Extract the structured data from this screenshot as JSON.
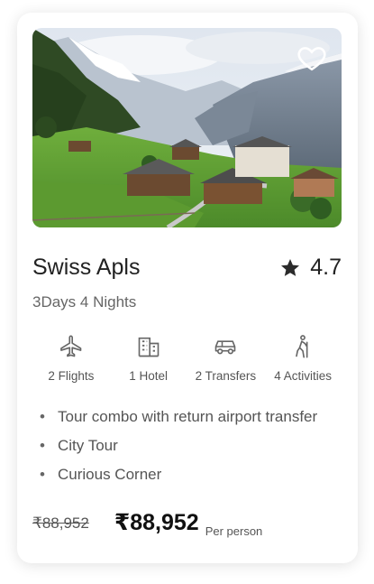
{
  "card": {
    "image_alt": "Swiss mountain village",
    "title": "Swiss Apls",
    "rating": "4.7",
    "subtitle": "3Days 4 Nights",
    "features": [
      {
        "icon": "flight-icon",
        "label": "2 Flights"
      },
      {
        "icon": "hotel-icon",
        "label": "1 Hotel"
      },
      {
        "icon": "car-icon",
        "label": "2 Transfers"
      },
      {
        "icon": "hiking-icon",
        "label": "4 Activities"
      }
    ],
    "highlights": [
      "Tour combo with return airport transfer",
      "City Tour",
      "Curious Corner"
    ],
    "old_price": "₹88,952",
    "price": "₹88,952",
    "price_note": "Per person",
    "favorite_icon": "heart-icon",
    "rating_icon": "star-icon"
  }
}
